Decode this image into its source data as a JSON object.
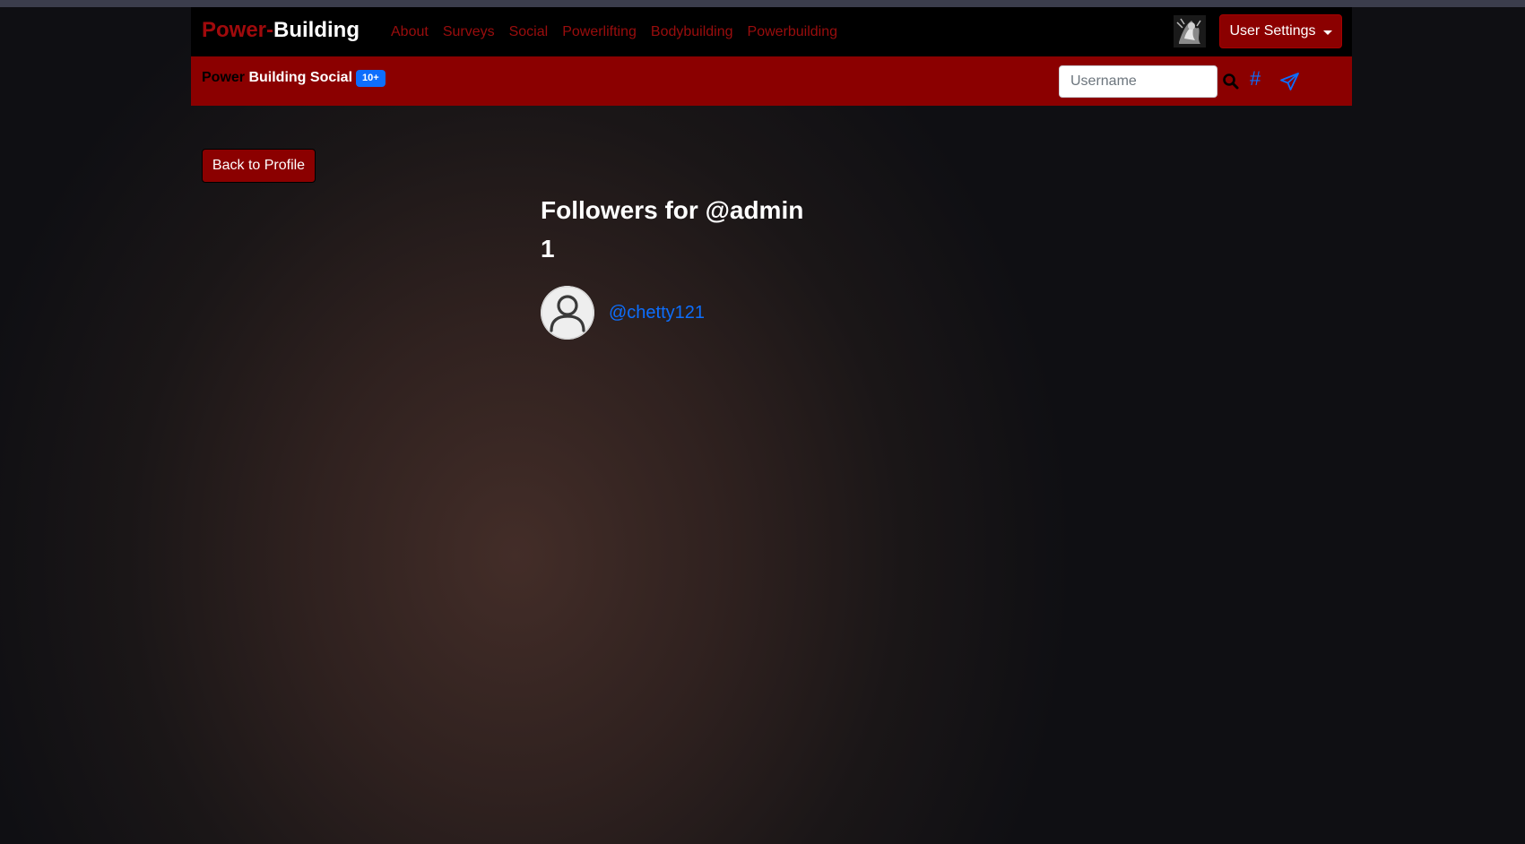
{
  "brand": {
    "part1": "Power-",
    "part2": "Building"
  },
  "nav": {
    "links": [
      "About",
      "Surveys",
      "Social",
      "Powerlifting",
      "Bodybuilding",
      "Powerbuilding"
    ],
    "user_settings_label": "User Settings"
  },
  "social": {
    "brand_part1": "Power",
    "brand_part2": " Building Social",
    "badge": "10+",
    "search_placeholder": "Username",
    "hash_label": "#"
  },
  "page": {
    "back_label": "Back to Profile",
    "title": "Followers for @admin",
    "count": "1",
    "followers": [
      {
        "username": "@chetty121"
      }
    ]
  },
  "colors": {
    "accent_red": "#8b0000",
    "link_blue": "#0d6efd",
    "nav_link_red": "#9a0d0d"
  },
  "icons": {
    "search": "search-icon",
    "hash": "hash-icon",
    "send": "send-icon",
    "avatar": "user-avatar-icon",
    "caret": "caret-down-icon"
  }
}
